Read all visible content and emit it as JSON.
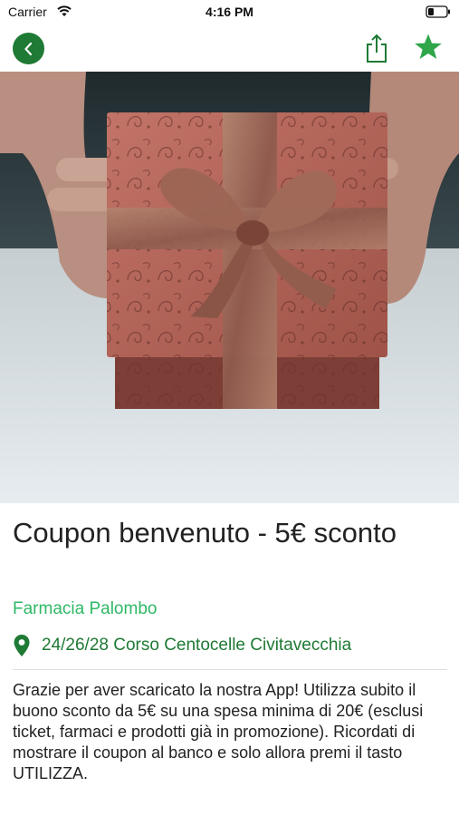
{
  "status_bar": {
    "carrier": "Carrier",
    "time": "4:16 PM"
  },
  "nav": {
    "back_icon": "chevron-left-icon",
    "share_icon": "share-icon",
    "favorite_icon": "star-icon"
  },
  "hero_image": {
    "subject": "gift box with ribbon bow held in two hands"
  },
  "coupon": {
    "title": "Coupon benvenuto - 5€ sconto",
    "merchant": "Farmacia Palombo",
    "address": "24/26/28 Corso Centocelle Civitavecchia",
    "description": "Grazie per aver scaricato la nostra App! Utilizza subito il buono sconto da 5€ su una spesa minima di 20€ (esclusi ticket, farmaci e prodotti già in promozione). Ricordati di mostrare il coupon al banco e solo allora premi il tasto UTILIZZA."
  },
  "colors": {
    "brand_dark_green": "#1e7a34",
    "accent_green": "#2fb865",
    "text": "#222222"
  }
}
